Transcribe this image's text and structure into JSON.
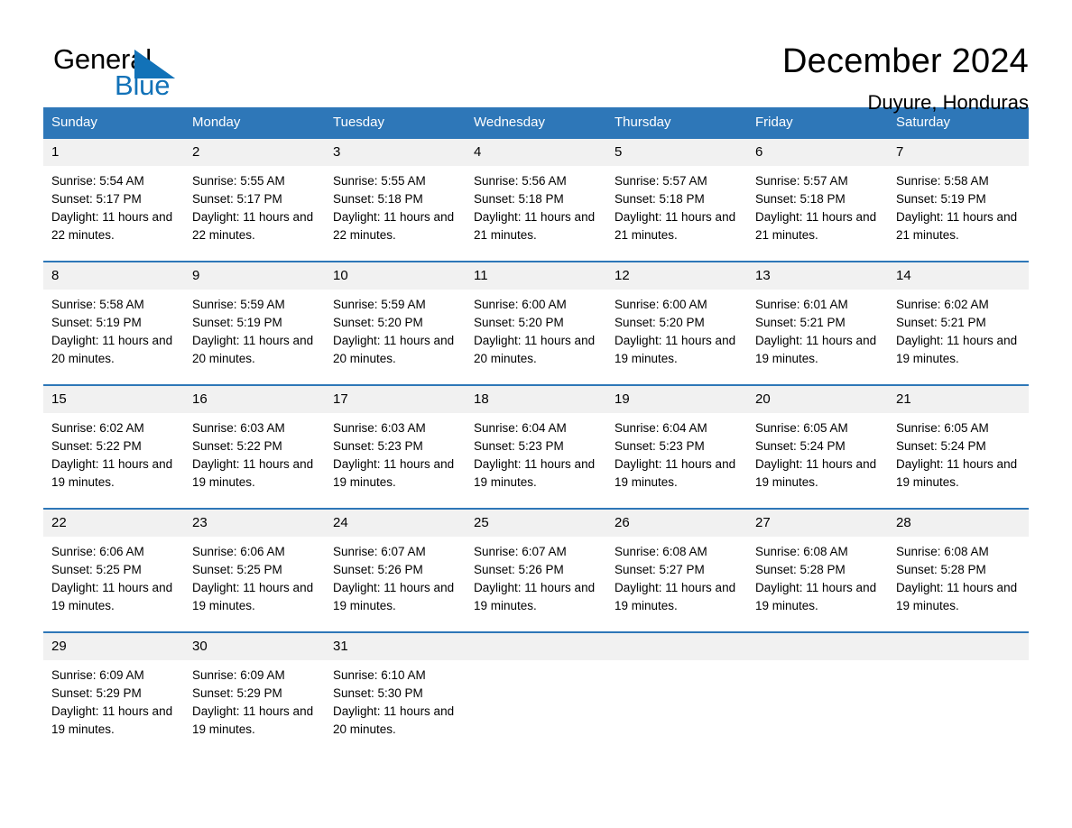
{
  "brand": {
    "name_part1": "General",
    "name_part2": "Blue",
    "accent_color": "#1272b8"
  },
  "header": {
    "title": "December 2024",
    "location": "Duyure, Honduras"
  },
  "calendar": {
    "header_background": "#2e77b8",
    "daynum_background": "#f1f1f1",
    "weekday_headers": [
      "Sunday",
      "Monday",
      "Tuesday",
      "Wednesday",
      "Thursday",
      "Friday",
      "Saturday"
    ],
    "weeks": [
      [
        {
          "day": "1",
          "sunrise": "Sunrise: 5:54 AM",
          "sunset": "Sunset: 5:17 PM",
          "daylight": "Daylight: 11 hours and 22 minutes."
        },
        {
          "day": "2",
          "sunrise": "Sunrise: 5:55 AM",
          "sunset": "Sunset: 5:17 PM",
          "daylight": "Daylight: 11 hours and 22 minutes."
        },
        {
          "day": "3",
          "sunrise": "Sunrise: 5:55 AM",
          "sunset": "Sunset: 5:18 PM",
          "daylight": "Daylight: 11 hours and 22 minutes."
        },
        {
          "day": "4",
          "sunrise": "Sunrise: 5:56 AM",
          "sunset": "Sunset: 5:18 PM",
          "daylight": "Daylight: 11 hours and 21 minutes."
        },
        {
          "day": "5",
          "sunrise": "Sunrise: 5:57 AM",
          "sunset": "Sunset: 5:18 PM",
          "daylight": "Daylight: 11 hours and 21 minutes."
        },
        {
          "day": "6",
          "sunrise": "Sunrise: 5:57 AM",
          "sunset": "Sunset: 5:18 PM",
          "daylight": "Daylight: 11 hours and 21 minutes."
        },
        {
          "day": "7",
          "sunrise": "Sunrise: 5:58 AM",
          "sunset": "Sunset: 5:19 PM",
          "daylight": "Daylight: 11 hours and 21 minutes."
        }
      ],
      [
        {
          "day": "8",
          "sunrise": "Sunrise: 5:58 AM",
          "sunset": "Sunset: 5:19 PM",
          "daylight": "Daylight: 11 hours and 20 minutes."
        },
        {
          "day": "9",
          "sunrise": "Sunrise: 5:59 AM",
          "sunset": "Sunset: 5:19 PM",
          "daylight": "Daylight: 11 hours and 20 minutes."
        },
        {
          "day": "10",
          "sunrise": "Sunrise: 5:59 AM",
          "sunset": "Sunset: 5:20 PM",
          "daylight": "Daylight: 11 hours and 20 minutes."
        },
        {
          "day": "11",
          "sunrise": "Sunrise: 6:00 AM",
          "sunset": "Sunset: 5:20 PM",
          "daylight": "Daylight: 11 hours and 20 minutes."
        },
        {
          "day": "12",
          "sunrise": "Sunrise: 6:00 AM",
          "sunset": "Sunset: 5:20 PM",
          "daylight": "Daylight: 11 hours and 19 minutes."
        },
        {
          "day": "13",
          "sunrise": "Sunrise: 6:01 AM",
          "sunset": "Sunset: 5:21 PM",
          "daylight": "Daylight: 11 hours and 19 minutes."
        },
        {
          "day": "14",
          "sunrise": "Sunrise: 6:02 AM",
          "sunset": "Sunset: 5:21 PM",
          "daylight": "Daylight: 11 hours and 19 minutes."
        }
      ],
      [
        {
          "day": "15",
          "sunrise": "Sunrise: 6:02 AM",
          "sunset": "Sunset: 5:22 PM",
          "daylight": "Daylight: 11 hours and 19 minutes."
        },
        {
          "day": "16",
          "sunrise": "Sunrise: 6:03 AM",
          "sunset": "Sunset: 5:22 PM",
          "daylight": "Daylight: 11 hours and 19 minutes."
        },
        {
          "day": "17",
          "sunrise": "Sunrise: 6:03 AM",
          "sunset": "Sunset: 5:23 PM",
          "daylight": "Daylight: 11 hours and 19 minutes."
        },
        {
          "day": "18",
          "sunrise": "Sunrise: 6:04 AM",
          "sunset": "Sunset: 5:23 PM",
          "daylight": "Daylight: 11 hours and 19 minutes."
        },
        {
          "day": "19",
          "sunrise": "Sunrise: 6:04 AM",
          "sunset": "Sunset: 5:23 PM",
          "daylight": "Daylight: 11 hours and 19 minutes."
        },
        {
          "day": "20",
          "sunrise": "Sunrise: 6:05 AM",
          "sunset": "Sunset: 5:24 PM",
          "daylight": "Daylight: 11 hours and 19 minutes."
        },
        {
          "day": "21",
          "sunrise": "Sunrise: 6:05 AM",
          "sunset": "Sunset: 5:24 PM",
          "daylight": "Daylight: 11 hours and 19 minutes."
        }
      ],
      [
        {
          "day": "22",
          "sunrise": "Sunrise: 6:06 AM",
          "sunset": "Sunset: 5:25 PM",
          "daylight": "Daylight: 11 hours and 19 minutes."
        },
        {
          "day": "23",
          "sunrise": "Sunrise: 6:06 AM",
          "sunset": "Sunset: 5:25 PM",
          "daylight": "Daylight: 11 hours and 19 minutes."
        },
        {
          "day": "24",
          "sunrise": "Sunrise: 6:07 AM",
          "sunset": "Sunset: 5:26 PM",
          "daylight": "Daylight: 11 hours and 19 minutes."
        },
        {
          "day": "25",
          "sunrise": "Sunrise: 6:07 AM",
          "sunset": "Sunset: 5:26 PM",
          "daylight": "Daylight: 11 hours and 19 minutes."
        },
        {
          "day": "26",
          "sunrise": "Sunrise: 6:08 AM",
          "sunset": "Sunset: 5:27 PM",
          "daylight": "Daylight: 11 hours and 19 minutes."
        },
        {
          "day": "27",
          "sunrise": "Sunrise: 6:08 AM",
          "sunset": "Sunset: 5:28 PM",
          "daylight": "Daylight: 11 hours and 19 minutes."
        },
        {
          "day": "28",
          "sunrise": "Sunrise: 6:08 AM",
          "sunset": "Sunset: 5:28 PM",
          "daylight": "Daylight: 11 hours and 19 minutes."
        }
      ],
      [
        {
          "day": "29",
          "sunrise": "Sunrise: 6:09 AM",
          "sunset": "Sunset: 5:29 PM",
          "daylight": "Daylight: 11 hours and 19 minutes."
        },
        {
          "day": "30",
          "sunrise": "Sunrise: 6:09 AM",
          "sunset": "Sunset: 5:29 PM",
          "daylight": "Daylight: 11 hours and 19 minutes."
        },
        {
          "day": "31",
          "sunrise": "Sunrise: 6:10 AM",
          "sunset": "Sunset: 5:30 PM",
          "daylight": "Daylight: 11 hours and 20 minutes."
        },
        {
          "day": "",
          "sunrise": "",
          "sunset": "",
          "daylight": ""
        },
        {
          "day": "",
          "sunrise": "",
          "sunset": "",
          "daylight": ""
        },
        {
          "day": "",
          "sunrise": "",
          "sunset": "",
          "daylight": ""
        },
        {
          "day": "",
          "sunrise": "",
          "sunset": "",
          "daylight": ""
        }
      ]
    ]
  }
}
